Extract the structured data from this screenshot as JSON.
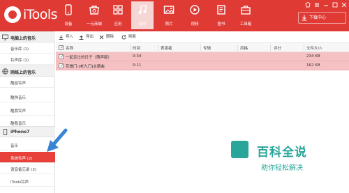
{
  "app": {
    "logo_text": "iTools"
  },
  "nav": [
    {
      "label": "设备",
      "icon": "phone-icon"
    },
    {
      "label": "一元商城",
      "icon": "shop-icon"
    },
    {
      "label": "应用",
      "icon": "apps-grid-icon"
    },
    {
      "label": "音乐",
      "icon": "music-note-icon",
      "active": true
    },
    {
      "label": "照片",
      "icon": "photo-icon"
    },
    {
      "label": "视频",
      "icon": "video-icon"
    },
    {
      "label": "图书",
      "icon": "book-icon"
    },
    {
      "label": "工具箱",
      "icon": "toolbox-icon"
    }
  ],
  "download_center": {
    "label": "下载中心"
  },
  "sidebar": {
    "sections": [
      {
        "title": "电脑上的音乐",
        "icon": "computer-icon",
        "items": [
          {
            "label": "音乐库 (1)"
          },
          {
            "label": "铃声库 (1)"
          }
        ]
      },
      {
        "title": "网络上的音乐",
        "icon": "globe-icon",
        "items": [
          {
            "label": "酷音铃声"
          },
          {
            "label": "酷狗音乐"
          },
          {
            "label": "酷我铃声"
          },
          {
            "label": "酷我音乐"
          }
        ]
      },
      {
        "title": "iPhone7",
        "icon": "iphone-icon",
        "items": [
          {
            "label": "音乐"
          },
          {
            "label": "系统铃声 (2)",
            "active": true
          },
          {
            "label": "语音备忘录 (3)"
          },
          {
            "label": "iTools铃声"
          }
        ]
      }
    ]
  },
  "toolbar": {
    "import": "导入",
    "export": "导出",
    "delete": "删除",
    "refresh": "刷新"
  },
  "table": {
    "columns": [
      "名称",
      "时间",
      "表演者",
      "专辑",
      "风格",
      "评分",
      "文件大小"
    ],
    "rows": [
      {
        "name": "一起走过的日子（萌声版）",
        "time": "0:34",
        "artist": "",
        "album": "",
        "genre": "",
        "rating": "",
        "size": "234 KB",
        "checked": true
      },
      {
        "name": "花僧门-[老九门]主题曲",
        "time": "0:11",
        "artist": "",
        "album": "",
        "genre": "",
        "rating": "",
        "size": "162 KB",
        "checked": true
      }
    ]
  },
  "watermark": {
    "title": "百科全说",
    "subtitle": "助你轻松解决"
  },
  "colors": {
    "brand_red": "#e03a35",
    "row_highlight": "#f6c1c3",
    "watermark_teal": "#2aa59a",
    "arrow_blue": "#3a84d6"
  }
}
